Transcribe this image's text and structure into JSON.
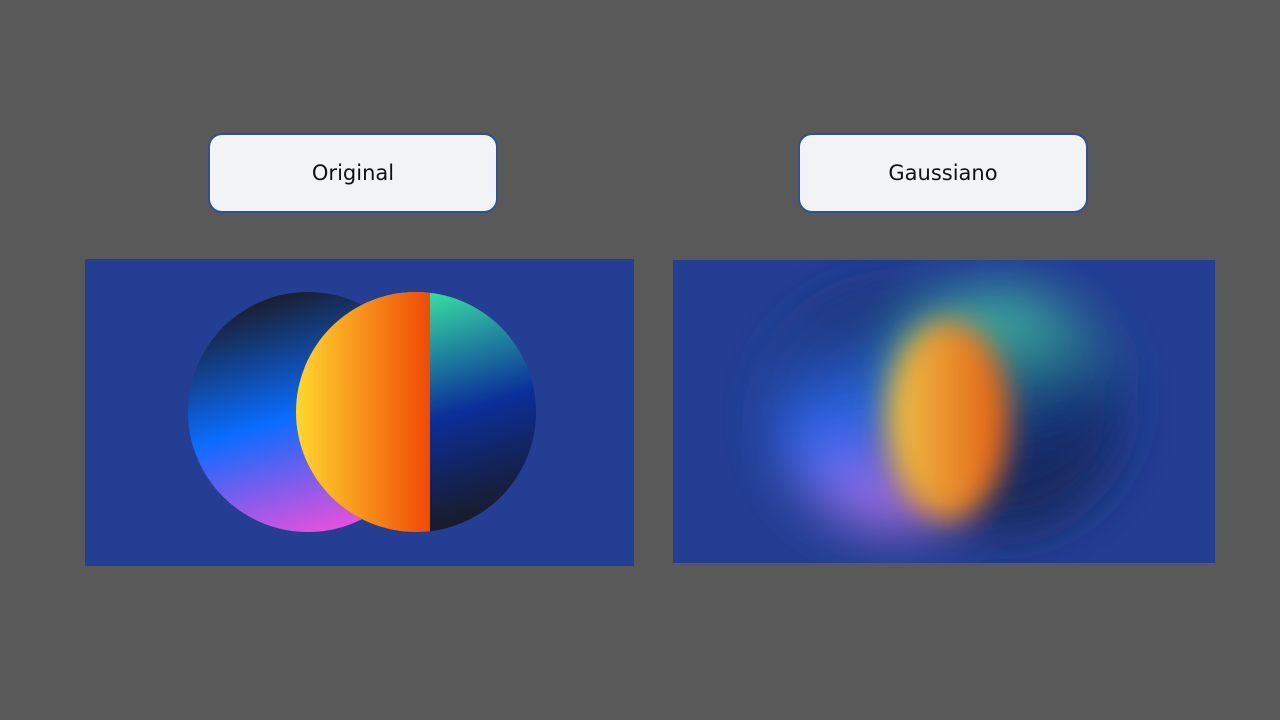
{
  "labels": {
    "original": "Original",
    "blurred": "Gaussiano"
  },
  "colors": {
    "background": "#595959",
    "panel": "#233e93",
    "label_fill": "#f2f3f4",
    "label_border": "#2f4f9a",
    "left_circle_gradient": [
      "#1b1b2a",
      "#0a6cff",
      "#ef4fdc"
    ],
    "right_circle_gradient": [
      "#3cf4a3",
      "#0b2e9a",
      "#1a1a22"
    ],
    "overlap_gradient": [
      "#ffd92f",
      "#f04a06"
    ]
  },
  "icons": {
    "original_image": "two-overlapping-gradient-circles",
    "blurred_image": "gaussian-blurred-gradient-circles"
  }
}
